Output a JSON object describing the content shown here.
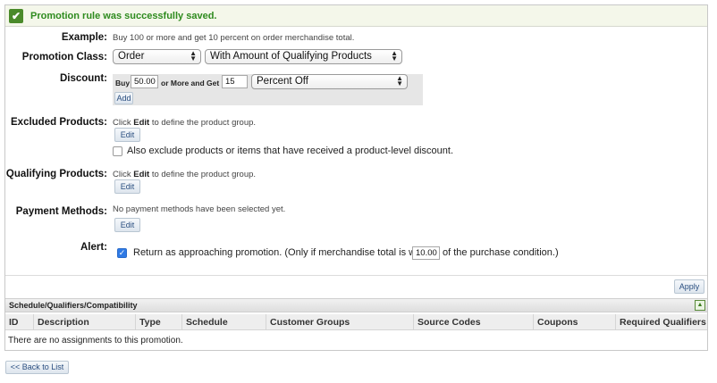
{
  "success": {
    "message": "Promotion rule was successfully saved."
  },
  "example": {
    "label": "Example:",
    "text": "Buy 100 or more and get 10 percent on order merchandise total."
  },
  "promotion_class": {
    "label": "Promotion Class:",
    "class_value": "Order",
    "type_value": "With Amount of Qualifying Products"
  },
  "discount": {
    "label": "Discount:",
    "buy_label": "Buy",
    "buy_value": "50.00",
    "middle_label": "or More and Get",
    "get_value": "15",
    "unit_value": "Percent Off",
    "add_label": "Add"
  },
  "excluded": {
    "label": "Excluded Products:",
    "hint_before": "Click ",
    "hint_bold": "Edit",
    "hint_after": " to define the product group.",
    "edit_label": "Edit",
    "also_exclude": "Also exclude products or items that have received a product-level discount."
  },
  "qualifying": {
    "label": "Qualifying Products:",
    "hint_before": "Click ",
    "hint_bold": "Edit",
    "hint_after": " to define the product group.",
    "edit_label": "Edit"
  },
  "payment": {
    "label": "Payment Methods:",
    "text": "No payment methods have been selected yet.",
    "edit_label": "Edit"
  },
  "alert": {
    "label": "Alert:",
    "text_before": "Return as approaching promotion. (Only if merchandise total is within",
    "value": "10.00",
    "text_after": "of the purchase condition.)"
  },
  "apply_label": "Apply",
  "schedule": {
    "title": "Schedule/Qualifiers/Compatibility",
    "columns": [
      "ID",
      "Description",
      "Type",
      "Schedule",
      "Customer Groups",
      "Source Codes",
      "Coupons",
      "Required Qualifiers"
    ],
    "empty_text": "There are no assignments to this promotion."
  },
  "back_label": "<< Back to List"
}
